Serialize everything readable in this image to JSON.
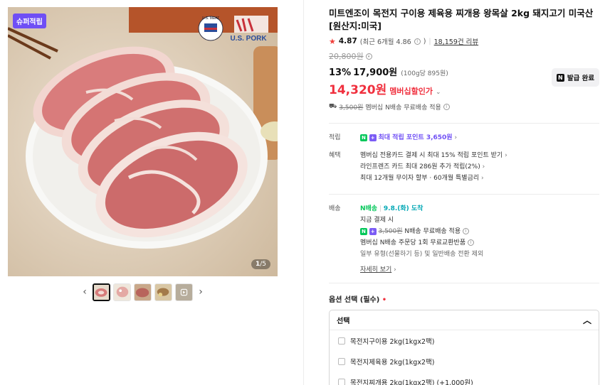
{
  "gallery": {
    "badge": "슈퍼적립",
    "counter_current": "1",
    "counter_total": "/5",
    "prev_icon": "‹",
    "next_icon": "›",
    "thumb_count": 5,
    "logo_top": "U.S. MEAT",
    "logo_bottom": "U.S. PORK"
  },
  "product": {
    "title": "미트엔조이 목전지 구이용 제육용 찌개용 왕목살 2kg 돼지고기 미국산 [원산지:미국]",
    "rating": "4.87",
    "rating_recent": "(최근 6개월 4.86",
    "rating_recent_close": ")",
    "review_count": "18,159건 리뷰",
    "original_price": "20,800원",
    "discount_rate": "13%",
    "sale_price": "17,900원",
    "unit_price": "(100g당 895원)",
    "member_price": "14,320원",
    "member_label": "멤버십할인가",
    "coupon_button": "발급 완료",
    "shipping_original": "3,500원",
    "shipping_text": "멤버십 N배송 무료배송 적용"
  },
  "benefits": {
    "point_key": "적립",
    "point_text": "최대 적립 포인트 3,650원",
    "benefit_key": "혜택",
    "benefit_lines": [
      "멤버십 전용카드 결제 시 최대 15% 적립 포인트 받기",
      "라인프렌즈 카드 최대 286원 추가 적립(2%)",
      "최대 12개월 무이자 할부 · 60개월 특별금리"
    ]
  },
  "delivery": {
    "key": "배송",
    "carrier": "N배송",
    "date": "9.8.(화) 도착",
    "condition": "지금 결제 시",
    "fee_original": "3,500원",
    "fee_text": "N배송 무료배송 적용",
    "exchange": "멤버십 N배송 주문당 1회 무료교환반품",
    "exclusion": "일부 유형(선물하기 등) 및 일반배송 전환 제외",
    "more": "자세히 보기"
  },
  "options": {
    "label": "옵션 선택 (필수)",
    "required_mark": "•",
    "selected": "선택",
    "items": [
      "목전지구이용 2kg(1kgx2팩)",
      "목전지제육용 2kg(1kgx2팩)",
      "목전지찌개용 2kg(1kgx2팩) (+1,000원)"
    ]
  },
  "colors": {
    "accent_red": "#f0303e",
    "accent_purple": "#6f4ff5",
    "naver_green": "#03c75a"
  }
}
